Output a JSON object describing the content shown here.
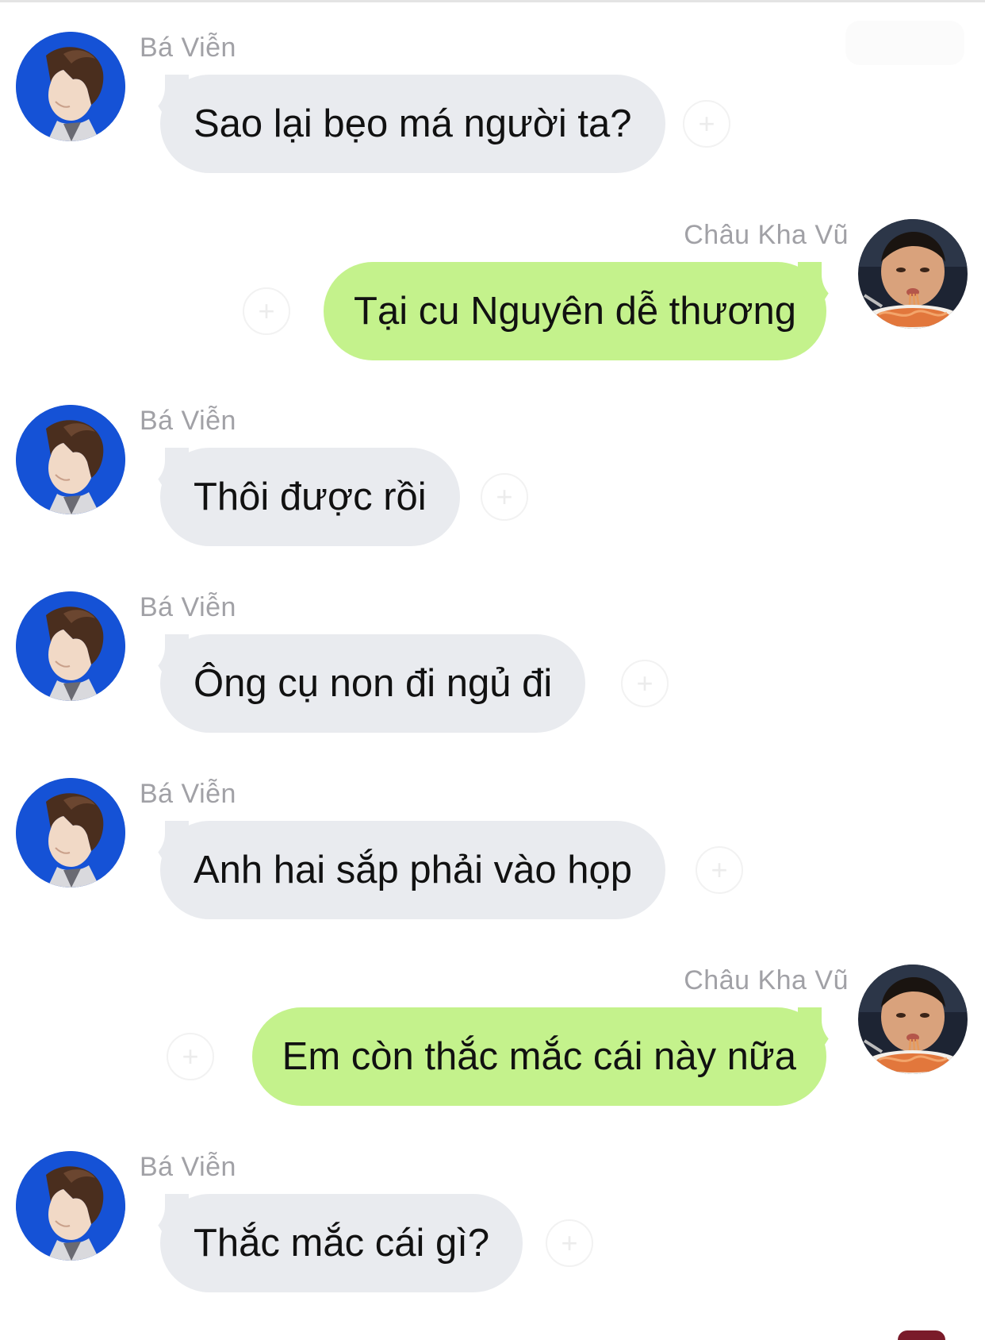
{
  "users": {
    "other": {
      "name": "Bá Viễn",
      "avatar_icon": "profile-photo-blue-portrait-icon"
    },
    "me": {
      "name": "Châu Kha Vũ",
      "avatar_icon": "profile-photo-child-eating-noodles-icon"
    }
  },
  "messages": [
    {
      "sender": "Bá Viễn",
      "text": "Sao lại bẹo má người ta?"
    },
    {
      "sender": "Châu Kha Vũ",
      "text": "Tại cu Nguyên dễ thương"
    },
    {
      "sender": "Bá Viễn",
      "text": "Thôi được rồi"
    },
    {
      "sender": "Bá Viễn",
      "text": "Ông cụ non đi ngủ đi"
    },
    {
      "sender": "Bá Viễn",
      "text": "Anh hai sắp phải vào họp"
    },
    {
      "sender": "Châu Kha Vũ",
      "text": "Em còn thắc mắc cái này nữa"
    },
    {
      "sender": "Bá Viễn",
      "text": "Thắc mắc cái gì?"
    }
  ],
  "colors": {
    "incoming_bubble": "#e9ebef",
    "outgoing_bubble": "#c4f28c",
    "name_text": "#a1a1a6",
    "message_text": "#111111"
  }
}
